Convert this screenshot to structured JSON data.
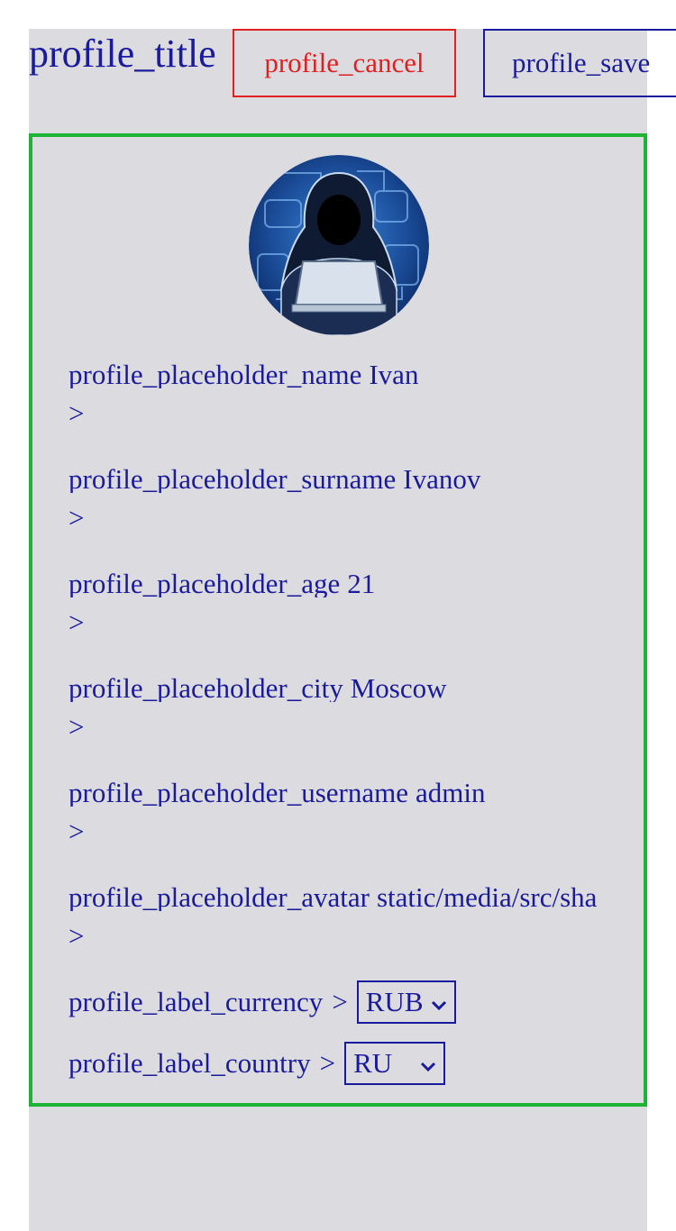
{
  "header": {
    "title": "profile_title",
    "cancel_label": "profile_cancel",
    "save_label": "profile_save"
  },
  "avatar": {
    "icon": "hacker-avatar-icon"
  },
  "fields": [
    {
      "label": "profile_placeholder_name",
      "value": "Ivan",
      "arrow": ">"
    },
    {
      "label": "profile_placeholder_surname",
      "value": "Ivanov",
      "arrow": ">"
    },
    {
      "label": "profile_placeholder_age",
      "value": "21",
      "arrow": ">"
    },
    {
      "label": "profile_placeholder_city",
      "value": "Moscow",
      "arrow": ">"
    },
    {
      "label": "profile_placeholder_username",
      "value": "admin",
      "arrow": ">"
    },
    {
      "label": "profile_placeholder_avatar",
      "value": "static/media/src/sha",
      "arrow": ">"
    }
  ],
  "currency": {
    "label": "profile_label_currency",
    "arrow": ">",
    "selected": "RUB"
  },
  "country": {
    "label": "profile_label_country",
    "arrow": ">",
    "selected": "RU"
  },
  "colors": {
    "text": "#1a1a9c",
    "cancel": "#e01f1f",
    "card_border": "#1db335",
    "background": "#dcdce0"
  }
}
